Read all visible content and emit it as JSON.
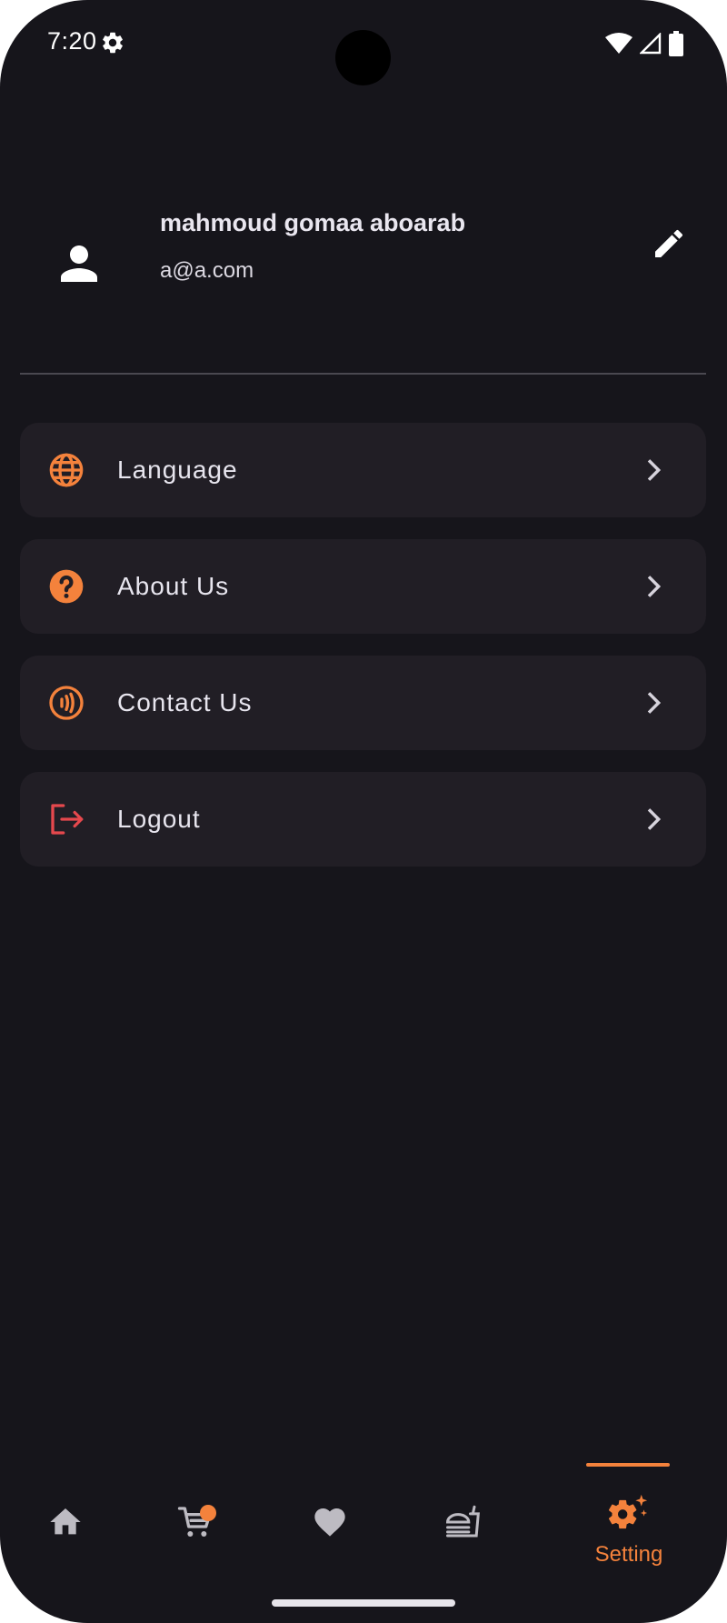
{
  "status_bar": {
    "time": "7:20",
    "icons": [
      "settings-icon",
      "wifi-icon",
      "signal-icon",
      "battery-icon"
    ]
  },
  "profile": {
    "name": "mahmoud gomaa aboarab",
    "email": "a@a.com",
    "avatar_icon": "person-icon",
    "edit_icon": "pencil-icon"
  },
  "menu": {
    "items": [
      {
        "label": "Language",
        "icon": "globe-icon",
        "color": "#f4823c"
      },
      {
        "label": "About Us",
        "icon": "help-icon",
        "color": "#f4823c"
      },
      {
        "label": "Contact Us",
        "icon": "contactless-icon",
        "color": "#f4823c"
      },
      {
        "label": "Logout",
        "icon": "logout-icon",
        "color": "#e5484d"
      }
    ]
  },
  "bottom_nav": {
    "items": [
      {
        "icon": "home-icon",
        "label": ""
      },
      {
        "icon": "cart-icon",
        "label": ""
      },
      {
        "icon": "heart-icon",
        "label": ""
      },
      {
        "icon": "food-icon",
        "label": ""
      },
      {
        "icon": "settings-sparkle-icon",
        "label": "Setting"
      }
    ],
    "active_index": 4
  },
  "colors": {
    "background": "#16151b",
    "card": "#211e25",
    "accent": "#f4823c",
    "danger": "#e5484d",
    "inactive": "#bdbbc2"
  }
}
